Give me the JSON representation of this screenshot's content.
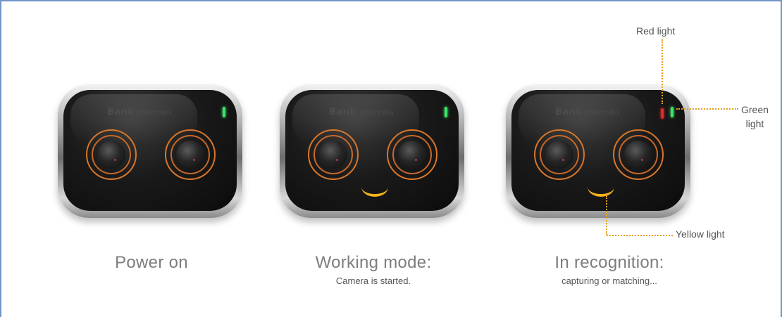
{
  "devices": [
    {
      "brand": "Bank",
      "brand_cn": "中国光大银行",
      "caption": "Power on",
      "subcaption": ""
    },
    {
      "brand": "Bank",
      "brand_cn": "中国光大银行",
      "caption": "Working mode:",
      "subcaption": "Camera is started."
    },
    {
      "brand": "Bank",
      "brand_cn": "中国光大银行",
      "caption": "In recognition:",
      "subcaption": "capturing or matching..."
    }
  ],
  "callouts": {
    "red": "Red light",
    "green_line1": "Green",
    "green_line2": "light",
    "yellow": "Yellow light"
  },
  "colors": {
    "frame": "#6f95c9",
    "lens_ring": "#d9762a",
    "led_green": "#3fe36a",
    "led_red": "#e22a2a",
    "smile_yellow": "#f2b21a",
    "callout_line": "#e5a11f"
  }
}
